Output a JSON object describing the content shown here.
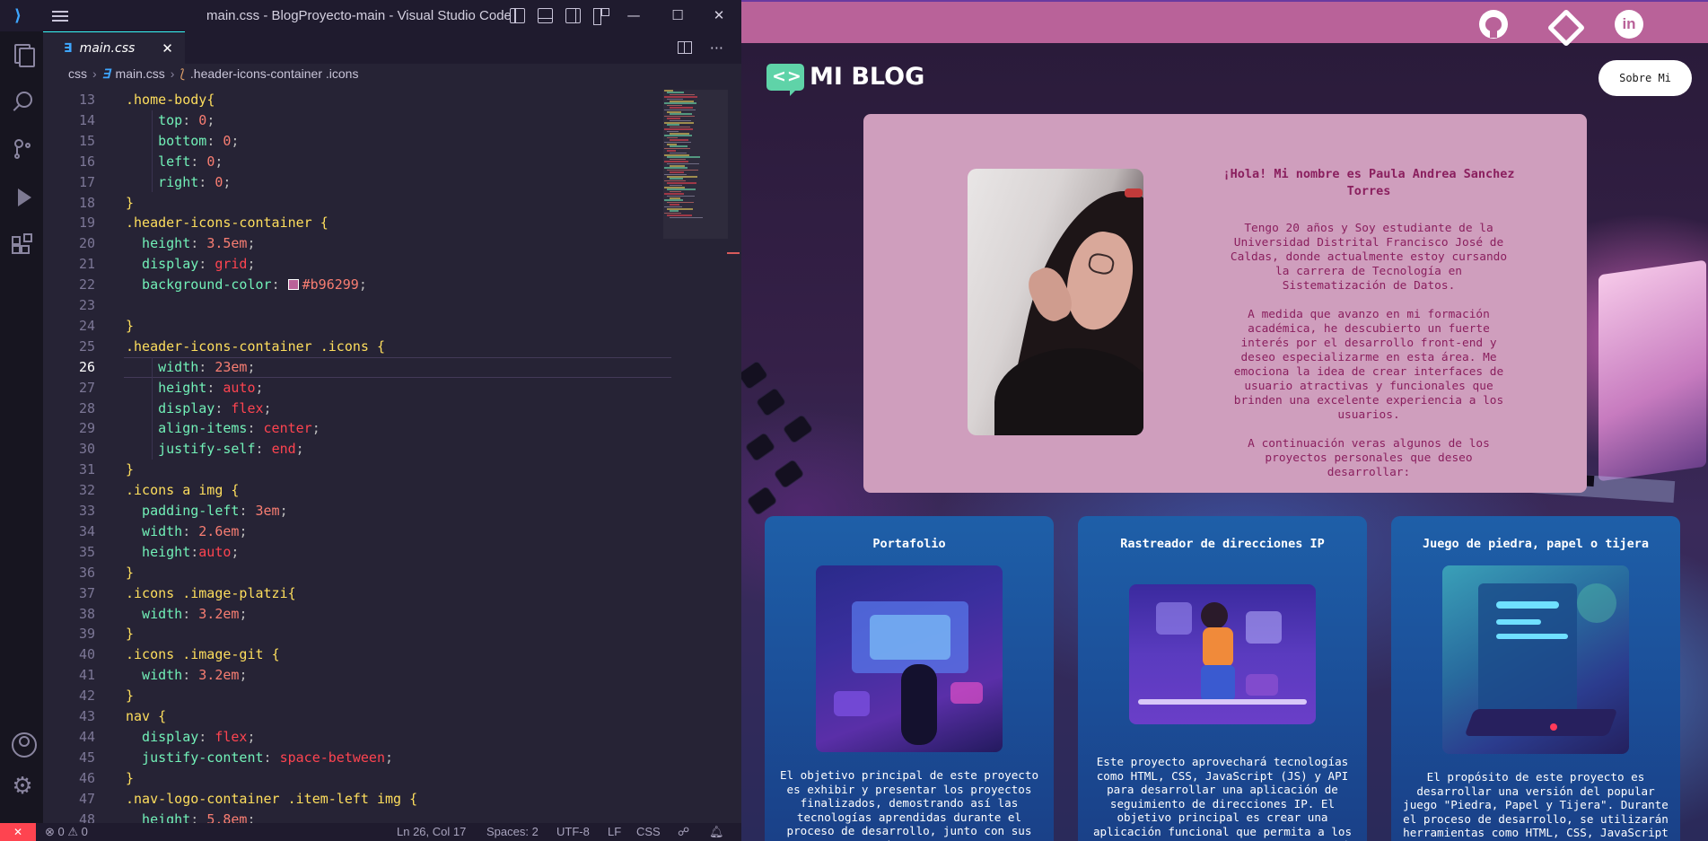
{
  "vscode": {
    "window_title": "main.css - BlogProyecto-main - Visual Studio Code",
    "tab": {
      "icon_label": "∃",
      "name": "main.css",
      "close": "✕"
    },
    "breadcrumb": {
      "folder": "css",
      "file": "main.css",
      "symbol": ".header-icons-container .icons",
      "file_icon": "∃",
      "symbol_icon": "⟅"
    },
    "cursor_line": 26,
    "lines": [
      {
        "n": "13",
        "tokens": [
          [
            "sel",
            ".home-body"
          ],
          [
            "brace",
            "{"
          ]
        ]
      },
      {
        "n": "14",
        "tokens": [
          [
            "prop",
            "    top"
          ],
          [
            "punc",
            ": "
          ],
          [
            "num",
            "0"
          ],
          [
            "punc",
            ";"
          ]
        ]
      },
      {
        "n": "15",
        "tokens": [
          [
            "prop",
            "    bottom"
          ],
          [
            "punc",
            ": "
          ],
          [
            "num",
            "0"
          ],
          [
            "punc",
            ";"
          ]
        ]
      },
      {
        "n": "16",
        "tokens": [
          [
            "prop",
            "    left"
          ],
          [
            "punc",
            ": "
          ],
          [
            "num",
            "0"
          ],
          [
            "punc",
            ";"
          ]
        ]
      },
      {
        "n": "17",
        "tokens": [
          [
            "prop",
            "    right"
          ],
          [
            "punc",
            ": "
          ],
          [
            "num",
            "0"
          ],
          [
            "punc",
            ";"
          ]
        ]
      },
      {
        "n": "18",
        "tokens": [
          [
            "brace",
            "}"
          ]
        ]
      },
      {
        "n": "19",
        "tokens": [
          [
            "sel",
            ".header-icons-container "
          ],
          [
            "brace",
            "{"
          ]
        ]
      },
      {
        "n": "20",
        "tokens": [
          [
            "prop",
            "  height"
          ],
          [
            "punc",
            ": "
          ],
          [
            "num",
            "3.5em"
          ],
          [
            "punc",
            ";"
          ]
        ]
      },
      {
        "n": "21",
        "tokens": [
          [
            "prop",
            "  display"
          ],
          [
            "punc",
            ": "
          ],
          [
            "kw",
            "grid"
          ],
          [
            "punc",
            ";"
          ]
        ]
      },
      {
        "n": "22",
        "tokens": [
          [
            "prop",
            "  background-color"
          ],
          [
            "punc",
            ": "
          ],
          [
            "swatch",
            "#b96299"
          ],
          [
            "hex",
            "#b96299"
          ],
          [
            "punc",
            ";"
          ]
        ]
      },
      {
        "n": "23",
        "tokens": []
      },
      {
        "n": "24",
        "tokens": [
          [
            "brace",
            "}"
          ]
        ]
      },
      {
        "n": "25",
        "tokens": [
          [
            "sel",
            ".header-icons-container .icons "
          ],
          [
            "brace",
            "{"
          ]
        ]
      },
      {
        "n": "26",
        "tokens": [
          [
            "prop",
            "    width"
          ],
          [
            "punc",
            ": "
          ],
          [
            "num",
            "23em"
          ],
          [
            "punc",
            ";"
          ]
        ]
      },
      {
        "n": "27",
        "tokens": [
          [
            "prop",
            "    height"
          ],
          [
            "punc",
            ": "
          ],
          [
            "kw",
            "auto"
          ],
          [
            "punc",
            ";"
          ]
        ]
      },
      {
        "n": "28",
        "tokens": [
          [
            "prop",
            "    display"
          ],
          [
            "punc",
            ": "
          ],
          [
            "kw",
            "flex"
          ],
          [
            "punc",
            ";"
          ]
        ]
      },
      {
        "n": "29",
        "tokens": [
          [
            "prop",
            "    align-items"
          ],
          [
            "punc",
            ": "
          ],
          [
            "kw",
            "center"
          ],
          [
            "punc",
            ";"
          ]
        ]
      },
      {
        "n": "30",
        "tokens": [
          [
            "prop",
            "    justify-self"
          ],
          [
            "punc",
            ": "
          ],
          [
            "kw",
            "end"
          ],
          [
            "punc",
            ";"
          ]
        ]
      },
      {
        "n": "31",
        "tokens": [
          [
            "brace",
            "}"
          ]
        ]
      },
      {
        "n": "32",
        "tokens": [
          [
            "sel",
            ".icons a img "
          ],
          [
            "brace",
            "{"
          ]
        ]
      },
      {
        "n": "33",
        "tokens": [
          [
            "prop",
            "  padding-left"
          ],
          [
            "punc",
            ": "
          ],
          [
            "num",
            "3em"
          ],
          [
            "punc",
            ";"
          ]
        ]
      },
      {
        "n": "34",
        "tokens": [
          [
            "prop",
            "  width"
          ],
          [
            "punc",
            ": "
          ],
          [
            "num",
            "2.6em"
          ],
          [
            "punc",
            ";"
          ]
        ]
      },
      {
        "n": "35",
        "tokens": [
          [
            "prop",
            "  height"
          ],
          [
            "punc",
            ":"
          ],
          [
            "kw",
            "auto"
          ],
          [
            "punc",
            ";"
          ]
        ]
      },
      {
        "n": "36",
        "tokens": [
          [
            "brace",
            "}"
          ]
        ]
      },
      {
        "n": "37",
        "tokens": [
          [
            "sel",
            ".icons .image-platzi"
          ],
          [
            "brace",
            "{"
          ]
        ]
      },
      {
        "n": "38",
        "tokens": [
          [
            "prop",
            "  width"
          ],
          [
            "punc",
            ": "
          ],
          [
            "num",
            "3.2em"
          ],
          [
            "punc",
            ";"
          ]
        ]
      },
      {
        "n": "39",
        "tokens": [
          [
            "brace",
            "}"
          ]
        ]
      },
      {
        "n": "40",
        "tokens": [
          [
            "sel",
            ".icons .image-git "
          ],
          [
            "brace",
            "{"
          ]
        ]
      },
      {
        "n": "41",
        "tokens": [
          [
            "prop",
            "  width"
          ],
          [
            "punc",
            ": "
          ],
          [
            "num",
            "3.2em"
          ],
          [
            "punc",
            ";"
          ]
        ]
      },
      {
        "n": "42",
        "tokens": [
          [
            "brace",
            "}"
          ]
        ]
      },
      {
        "n": "43",
        "tokens": [
          [
            "sel",
            "nav "
          ],
          [
            "brace",
            "{"
          ]
        ]
      },
      {
        "n": "44",
        "tokens": [
          [
            "prop",
            "  display"
          ],
          [
            "punc",
            ": "
          ],
          [
            "kw",
            "flex"
          ],
          [
            "punc",
            ";"
          ]
        ]
      },
      {
        "n": "45",
        "tokens": [
          [
            "prop",
            "  justify-content"
          ],
          [
            "punc",
            ": "
          ],
          [
            "kw",
            "space-between"
          ],
          [
            "punc",
            ";"
          ]
        ]
      },
      {
        "n": "46",
        "tokens": [
          [
            "brace",
            "}"
          ]
        ]
      },
      {
        "n": "47",
        "tokens": [
          [
            "sel",
            ".nav-logo-container .item-left img "
          ],
          [
            "brace",
            "{"
          ]
        ]
      },
      {
        "n": "48",
        "tokens": [
          [
            "prop",
            "  height"
          ],
          [
            "punc",
            ": "
          ],
          [
            "num",
            "5.8em"
          ],
          [
            "punc",
            ";"
          ]
        ]
      }
    ],
    "status": {
      "problems": "⊗ 0 ⚠ 0",
      "position": "Ln 26, Col 17",
      "spaces": "Spaces: 2",
      "encoding": "UTF-8",
      "eol": "LF",
      "language": "CSS"
    },
    "colors": {
      "accent": "#36f9f6",
      "remote": "#fe4450"
    }
  },
  "browser": {
    "logo_text": "MI BLOG",
    "nav_button": "Sobre Mi",
    "social": {
      "github": "github-icon",
      "platzi": "platzi-icon",
      "linkedin": "in"
    },
    "intro": {
      "title": "¡Hola! Mi nombre es Paula Andrea Sanchez Torres",
      "paragraphs": [
        "Tengo 20 años y Soy estudiante de la Universidad Distrital Francisco José de Caldas, donde actualmente estoy cursando la carrera de Tecnología en Sistematización de Datos.",
        "A medida que avanzo en mi formación académica, he descubierto un fuerte interés por el desarrollo front-end y deseo especializarme en esta área. Me emociona la idea de crear interfaces de usuario atractivas y funcionales que brinden una excelente experiencia a los usuarios.",
        "A continuación veras algunos de los proyectos personales que deseo desarrollar:"
      ]
    },
    "cards": [
      {
        "title": "Portafolio",
        "desc": "El objetivo principal de este proyecto es exhibir y presentar los proyectos finalizados, demostrando así las tecnologías aprendidas durante el proceso de desarrollo, junto con sus respectivos procesos."
      },
      {
        "title": "Rastreador de direcciones IP",
        "desc": "Este proyecto aprovechará tecnologías como HTML, CSS, JavaScript (JS) y API para desarrollar una aplicación de seguimiento de direcciones IP. El objetivo principal es crear una aplicación funcional que permita a los usuarios rastrear y obtener información"
      },
      {
        "title": "Juego de piedra, papel o tijera",
        "desc": "El propósito de este proyecto es desarrollar una versión del popular juego \"Piedra, Papel y Tijera\". Durante el proceso de desarrollo, se utilizarán herramientas como HTML, CSS, JavaScript y React"
      }
    ],
    "colors": {
      "header": "#b96299",
      "intro_bg": "#cf9ebd",
      "intro_text": "#8a1f5e",
      "card_bg": "#1e5fa8"
    }
  }
}
